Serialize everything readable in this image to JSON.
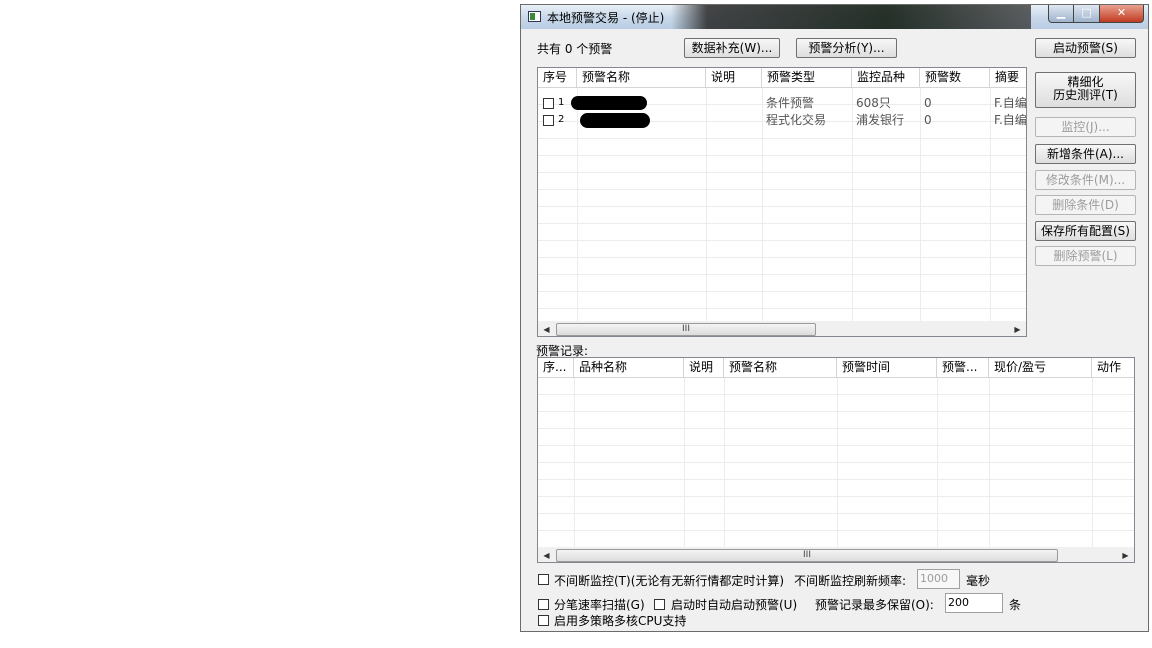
{
  "window": {
    "title": "本地预警交易 - (停止)"
  },
  "top": {
    "count_label": "共有 0 个预警",
    "data_fill_btn": "数据补充(W)...",
    "analysis_btn": "预警分析(Y)..."
  },
  "side": {
    "start_btn": "启动预警(S)",
    "refine_line1": "精细化",
    "refine_line2": "历史测评(T)",
    "monitor_btn": "监控(J)...",
    "add_btn": "新增条件(A)...",
    "modify_btn": "修改条件(M)...",
    "delete_cond_btn": "删除条件(D)",
    "save_btn": "保存所有配置(S)",
    "delete_alert_btn": "删除预警(L)"
  },
  "alerts_table": {
    "columns": [
      "序号",
      "预警名称",
      "说明",
      "预警类型",
      "监控品种",
      "预警数",
      "摘要"
    ],
    "rows": [
      {
        "index": "1",
        "type": "条件预警",
        "instrument": "608只",
        "count": "0",
        "summary": "F.自编"
      },
      {
        "index": "2",
        "type": "程式化交易",
        "instrument": "浦发银行",
        "count": "0",
        "summary": "F.自编"
      }
    ]
  },
  "records": {
    "label": "预警记录:",
    "columns": [
      "序...",
      "品种名称",
      "说明",
      "预警名称",
      "预警时间",
      "预警...",
      "现价/盈亏",
      "动作"
    ]
  },
  "scroll": {
    "thumb_glyph": "III",
    "left_arrow": "◀",
    "right_arrow": "▶"
  },
  "options": {
    "continuous_label": "不间断监控(T)(无论有无新行情都定时计算)",
    "refresh_label": "不间断监控刷新频率:",
    "refresh_value": "1000",
    "refresh_unit": "毫秒",
    "tick_scan_label": "分笔速率扫描(G)",
    "auto_start_label": "启动时自动启动预警(U)",
    "keep_label": "预警记录最多保留(O):",
    "keep_value": "200",
    "keep_unit": "条",
    "multicore_label": "启用多策略多核CPU支持"
  }
}
